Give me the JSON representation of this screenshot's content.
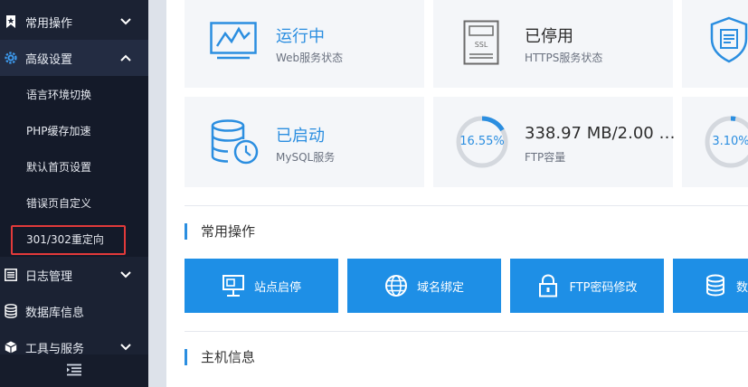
{
  "sidebar": {
    "menus": {
      "common_ops": "常用操作",
      "advanced": "高级设置",
      "logs": "日志管理",
      "database": "数据库信息",
      "tools": "工具与服务"
    },
    "submenu": {
      "language_switch": "语言环境切换",
      "php_cache": "PHP缓存加速",
      "default_homepage": "默认首页设置",
      "error_page": "错误页自定义",
      "redirect": "301/302重定向"
    }
  },
  "status": {
    "web": {
      "title": "运行中",
      "desc": "Web服务状态"
    },
    "https": {
      "title": "已停用",
      "desc": "HTTPS服务状态"
    },
    "mysql": {
      "title": "已启动",
      "desc": "MySQL服务"
    },
    "ftp": {
      "percent": "16.55%",
      "title": "338.97 MB/2.00 …",
      "desc": "FTP容量",
      "fraction": 0.1655
    },
    "third": {
      "percent": "3.10%",
      "fraction": 0.031
    }
  },
  "sections": {
    "common_ops": "常用操作",
    "host_info": "主机信息"
  },
  "quick_actions": {
    "site_toggle": "站点启停",
    "domain_bind": "域名绑定",
    "ftp_password": "FTP密码修改",
    "database": "数"
  },
  "colors": {
    "accent": "#1e8fe6",
    "sidebar_bg": "#1b2233",
    "highlight": "#e23a3a"
  }
}
